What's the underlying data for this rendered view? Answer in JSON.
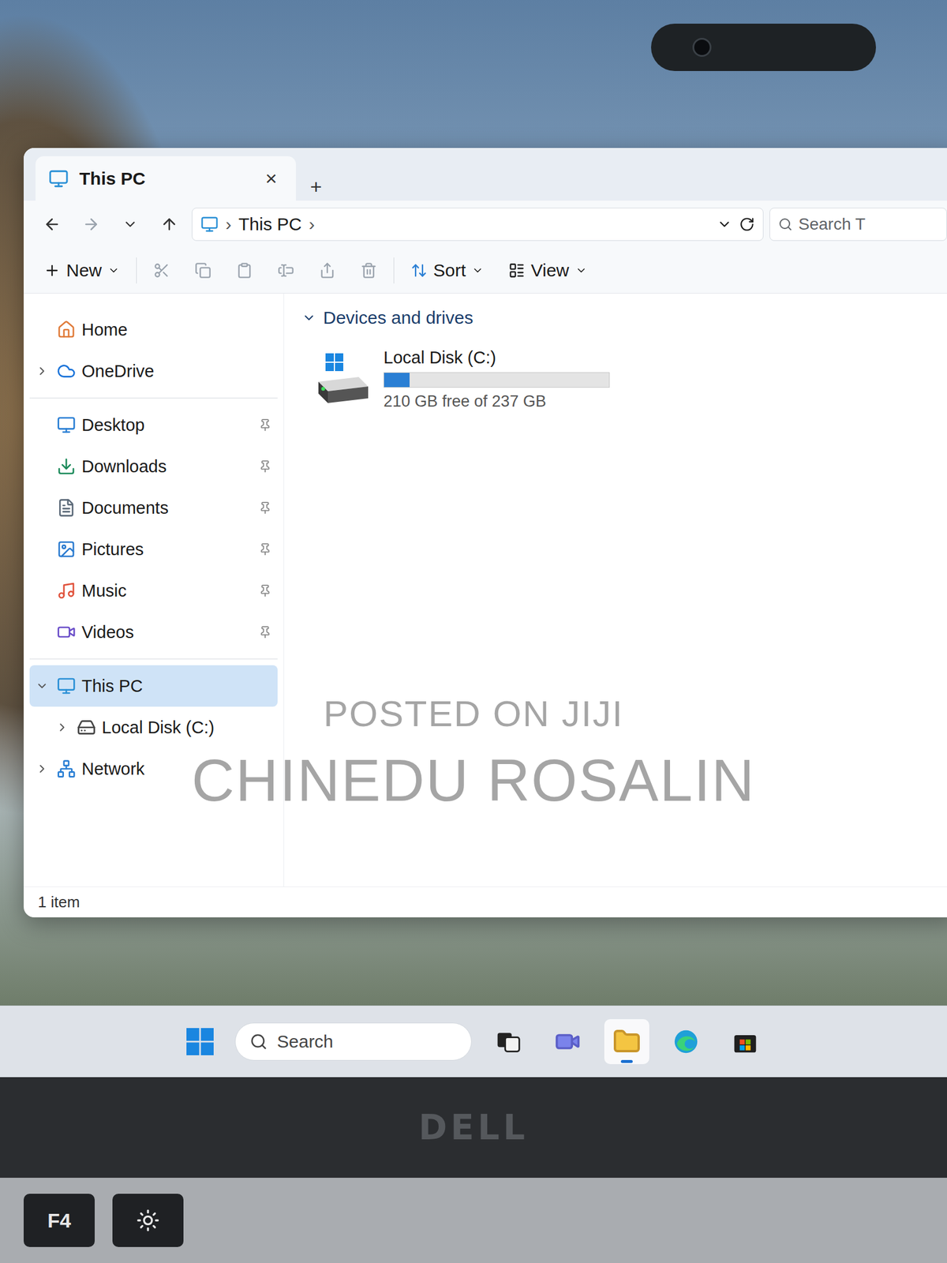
{
  "window": {
    "title": "This PC",
    "tab_close": "×",
    "new_tab": "+"
  },
  "toolbar": {
    "new": "New",
    "sort": "Sort",
    "view": "View"
  },
  "address": {
    "path": [
      "This PC"
    ],
    "separator": "›"
  },
  "search": {
    "placeholder": "Search T"
  },
  "sidebar": {
    "sections": [
      [
        {
          "label": "Home",
          "kind": "home",
          "expandable": false,
          "expanded": false,
          "pinned": false,
          "selected": false,
          "children": []
        },
        {
          "label": "OneDrive",
          "kind": "onedrive",
          "expandable": true,
          "expanded": false,
          "pinned": false,
          "selected": false,
          "children": []
        }
      ],
      [
        {
          "label": "Desktop",
          "kind": "desktop",
          "expandable": false,
          "expanded": false,
          "pinned": true,
          "selected": false,
          "children": []
        },
        {
          "label": "Downloads",
          "kind": "downloads",
          "expandable": false,
          "expanded": false,
          "pinned": true,
          "selected": false,
          "children": []
        },
        {
          "label": "Documents",
          "kind": "documents",
          "expandable": false,
          "expanded": false,
          "pinned": true,
          "selected": false,
          "children": []
        },
        {
          "label": "Pictures",
          "kind": "pictures",
          "expandable": false,
          "expanded": false,
          "pinned": true,
          "selected": false,
          "children": []
        },
        {
          "label": "Music",
          "kind": "music",
          "expandable": false,
          "expanded": false,
          "pinned": true,
          "selected": false,
          "children": []
        },
        {
          "label": "Videos",
          "kind": "videos",
          "expandable": false,
          "expanded": false,
          "pinned": true,
          "selected": false,
          "children": []
        }
      ],
      [
        {
          "label": "This PC",
          "kind": "thispc",
          "expandable": true,
          "expanded": true,
          "pinned": false,
          "selected": true,
          "children": [
            {
              "label": "Local Disk (C:)",
              "kind": "disk",
              "expandable": true,
              "expanded": false,
              "pinned": false,
              "selected": false,
              "children": []
            }
          ]
        },
        {
          "label": "Network",
          "kind": "network",
          "expandable": true,
          "expanded": false,
          "pinned": false,
          "selected": false,
          "children": []
        }
      ]
    ]
  },
  "groups": [
    {
      "label": "Devices and drives",
      "expanded": true,
      "drives": [
        {
          "name": "Local Disk (C:)",
          "free": "210 GB free of 237 GB",
          "level": 0.114
        }
      ]
    }
  ],
  "status_bar": {
    "count": "1 item"
  },
  "taskbar": {
    "search": {
      "placeholder": "Search"
    },
    "apps": [
      {
        "kind": "taskview",
        "active": false
      },
      {
        "kind": "chat",
        "active": false
      },
      {
        "kind": "explorer",
        "active": true
      },
      {
        "kind": "edge",
        "active": false
      },
      {
        "kind": "store",
        "active": false
      }
    ]
  },
  "watermark": [
    "POSTED ON JIJI",
    "CHINEDU ROSALIN"
  ],
  "laptop": {
    "brand": "DELL",
    "keys": [
      "F4"
    ]
  }
}
